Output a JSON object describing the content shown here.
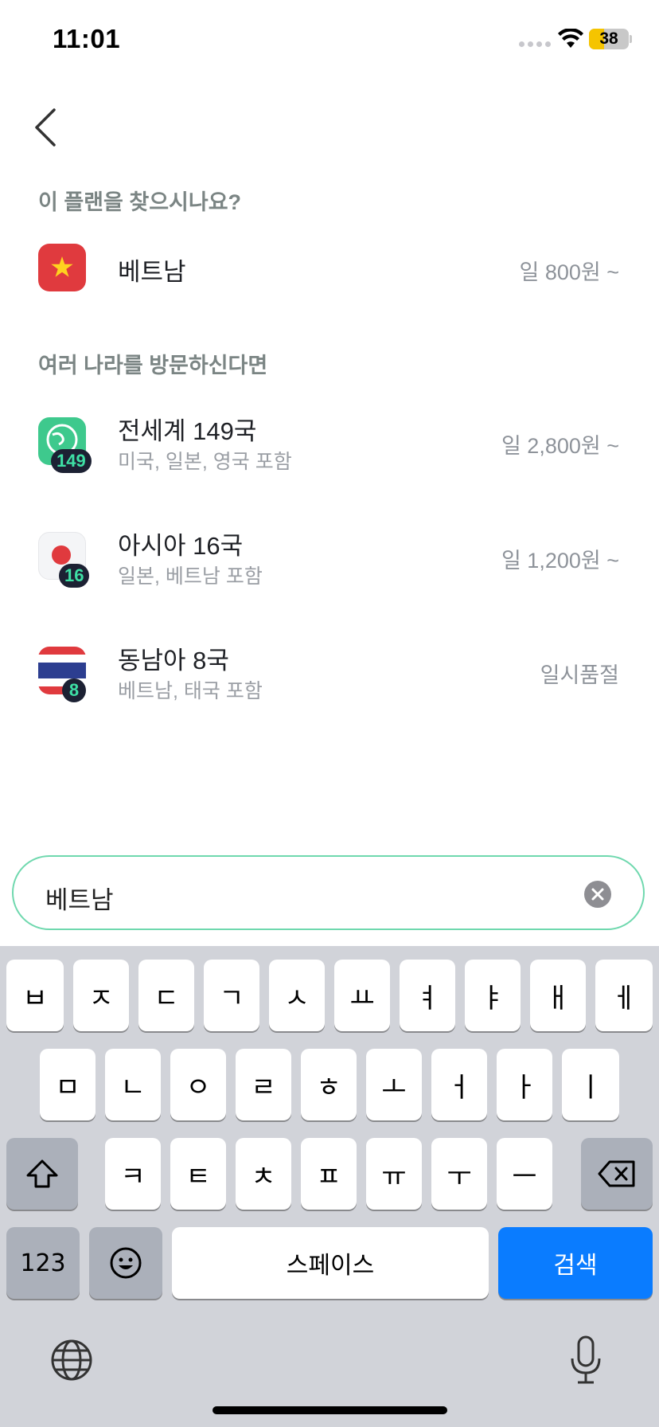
{
  "status_bar": {
    "time": "11:01",
    "battery_level": "38"
  },
  "sections": {
    "suggest_title": "이 플랜을 찾으시나요?",
    "multi_title": "여러 나라를 방문하신다면"
  },
  "suggest_item": {
    "name": "베트남",
    "price": "일 800원 ~"
  },
  "plans": [
    {
      "name": "전세계 149국",
      "sub": "미국, 일본, 영국 포함",
      "price": "일 2,800원 ~",
      "badge": "149"
    },
    {
      "name": "아시아 16국",
      "sub": "일본, 베트남 포함",
      "price": "일 1,200원 ~",
      "badge": "16"
    },
    {
      "name": "동남아 8국",
      "sub": "베트남, 태국 포함",
      "price": "일시품절",
      "badge": "8"
    }
  ],
  "search": {
    "value": "베트남"
  },
  "keyboard": {
    "row1": [
      "ㅂ",
      "ㅈ",
      "ㄷ",
      "ㄱ",
      "ㅅ",
      "ㅛ",
      "ㅕ",
      "ㅑ",
      "ㅐ",
      "ㅔ"
    ],
    "row2": [
      "ㅁ",
      "ㄴ",
      "ㅇ",
      "ㄹ",
      "ㅎ",
      "ㅗ",
      "ㅓ",
      "ㅏ",
      "ㅣ"
    ],
    "row3": [
      "ㅋ",
      "ㅌ",
      "ㅊ",
      "ㅍ",
      "ㅠ",
      "ㅜ",
      "ㅡ"
    ],
    "numbers_label": "123",
    "space_label": "스페이스",
    "search_label": "검색"
  },
  "colors": {
    "accent": "#3ee0a5",
    "search_border": "#6fd8ae",
    "keyboard_blue": "#0a7cff"
  }
}
